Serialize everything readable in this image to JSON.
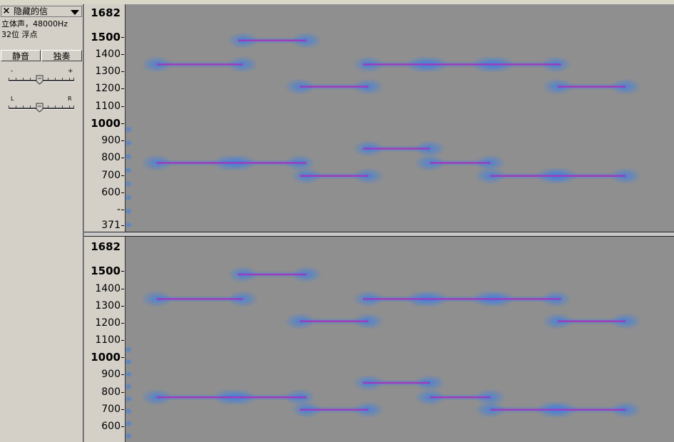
{
  "track": {
    "name": "隐藏的信",
    "info_line1": "立体声，48000Hz",
    "info_line2": "32位 浮点",
    "mute_label": "静音",
    "solo_label": "独奏",
    "gain_minus": "-",
    "gain_plus": "+",
    "pan_left": "L",
    "pan_right": "R"
  },
  "ruler_top": {
    "labels": [
      "1682",
      "1500",
      "1400",
      "1300",
      "1200",
      "1100",
      "1000",
      "900",
      "800",
      "700",
      "600",
      "-",
      "371"
    ]
  },
  "ruler_bottom": {
    "labels": [
      "1682",
      "1500",
      "1400",
      "1300",
      "1200",
      "1100",
      "1000",
      "900",
      "800",
      "700",
      "600"
    ]
  },
  "colors": {
    "spectrogram_bg": "#8f8f8f",
    "tone_line": "#9a3dbf",
    "tone_glow": "#3f7fe0"
  },
  "tones": [
    {
      "start": 0.057,
      "end": 0.214,
      "freq": 1340
    },
    {
      "start": 0.205,
      "end": 0.33,
      "freq": 1480
    },
    {
      "start": 0.318,
      "end": 0.443,
      "freq": 1210
    },
    {
      "start": 0.433,
      "end": 0.794,
      "freq": 1340
    },
    {
      "start": 0.788,
      "end": 0.912,
      "freq": 1210
    },
    {
      "start": 0.057,
      "end": 0.33,
      "freq": 770
    },
    {
      "start": 0.318,
      "end": 0.443,
      "freq": 697
    },
    {
      "start": 0.433,
      "end": 0.555,
      "freq": 852
    },
    {
      "start": 0.555,
      "end": 0.665,
      "freq": 770
    },
    {
      "start": 0.665,
      "end": 0.912,
      "freq": 697
    }
  ],
  "tone_blobs": [
    {
      "t": 0.057,
      "freq": 1340
    },
    {
      "t": 0.214,
      "freq": 1340
    },
    {
      "t": 0.214,
      "freq": 1480
    },
    {
      "t": 0.33,
      "freq": 1480
    },
    {
      "t": 0.318,
      "freq": 1210
    },
    {
      "t": 0.443,
      "freq": 1210
    },
    {
      "t": 0.443,
      "freq": 1340
    },
    {
      "t": 0.54,
      "freq": 1340
    },
    {
      "t": 0.56,
      "freq": 1340
    },
    {
      "t": 0.66,
      "freq": 1340
    },
    {
      "t": 0.68,
      "freq": 1340
    },
    {
      "t": 0.785,
      "freq": 1340
    },
    {
      "t": 0.788,
      "freq": 1210
    },
    {
      "t": 0.912,
      "freq": 1210
    },
    {
      "t": 0.057,
      "freq": 770
    },
    {
      "t": 0.188,
      "freq": 770
    },
    {
      "t": 0.21,
      "freq": 770
    },
    {
      "t": 0.318,
      "freq": 770
    },
    {
      "t": 0.33,
      "freq": 697
    },
    {
      "t": 0.443,
      "freq": 697
    },
    {
      "t": 0.443,
      "freq": 852
    },
    {
      "t": 0.555,
      "freq": 852
    },
    {
      "t": 0.555,
      "freq": 770
    },
    {
      "t": 0.665,
      "freq": 770
    },
    {
      "t": 0.665,
      "freq": 697
    },
    {
      "t": 0.777,
      "freq": 697
    },
    {
      "t": 0.795,
      "freq": 697
    },
    {
      "t": 0.912,
      "freq": 697
    }
  ]
}
